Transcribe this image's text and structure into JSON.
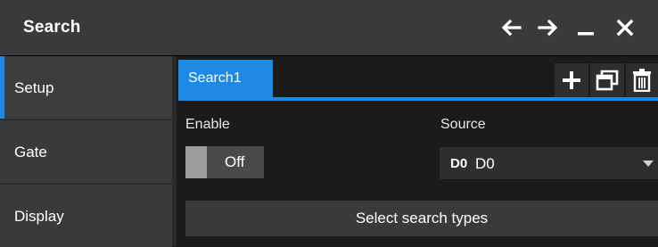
{
  "window": {
    "title": "Search",
    "controls": {
      "back": "arrow-left-icon",
      "forward": "arrow-right-icon",
      "minimize": "minimize-icon",
      "close": "close-icon"
    }
  },
  "sidebar": {
    "items": [
      {
        "label": "Setup",
        "active": true
      },
      {
        "label": "Gate",
        "active": false
      },
      {
        "label": "Display",
        "active": false
      }
    ]
  },
  "tabs": {
    "items": [
      {
        "label": "Search1",
        "active": true
      }
    ],
    "actions": {
      "add": "plus-icon",
      "copy": "copy-icon",
      "delete": "trash-icon"
    }
  },
  "setup": {
    "enable_label": "Enable",
    "enable_value": "Off",
    "source_label": "Source",
    "source_tag": "D0",
    "source_value": "D0",
    "select_types_label": "Select search types"
  },
  "colors": {
    "accent": "#1e88e5",
    "background": "#1b1b1b",
    "panel": "#3a3a3a"
  }
}
